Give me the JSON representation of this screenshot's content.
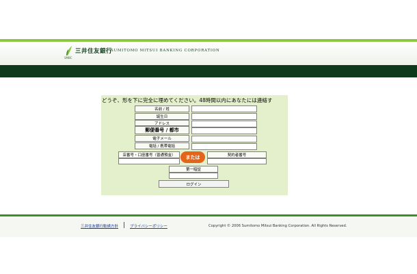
{
  "brand": {
    "name_jp": "三井住友銀行",
    "name_en": "SUMITOMO MITSUI BANKING CORPORATION",
    "mark_sub": "SMBC",
    "colors": {
      "leaf_green": "#8dc63f",
      "dark_green": "#0e3a1b",
      "panel_green": "#e4f0cc",
      "accent_orange": "#e3641b"
    }
  },
  "form": {
    "instruction": "どうぞ、形を下に完全に埋めてください。48時間以内にあなたには連絡す",
    "fields": {
      "name": "名前 / 姓",
      "birthday": "誕生日",
      "address": "アドレス",
      "postal": "郵便番号 / 都市",
      "email": "電子メール",
      "phone": "電話 / 携帯電話",
      "branch_account": "店番号・口座番号（普通預金）",
      "contract_no": "契約者番号",
      "first_pin": "第一暗証"
    },
    "or_label": "または",
    "login_label": "ログイン"
  },
  "footer": {
    "link_policy": "三井住友銀行勧誘方針",
    "link_privacy": "プライバシーポリシー",
    "copyright": "Copyright © 2006 Sumitomo Mitsui Banking Corporation. All Rights Reserved."
  }
}
